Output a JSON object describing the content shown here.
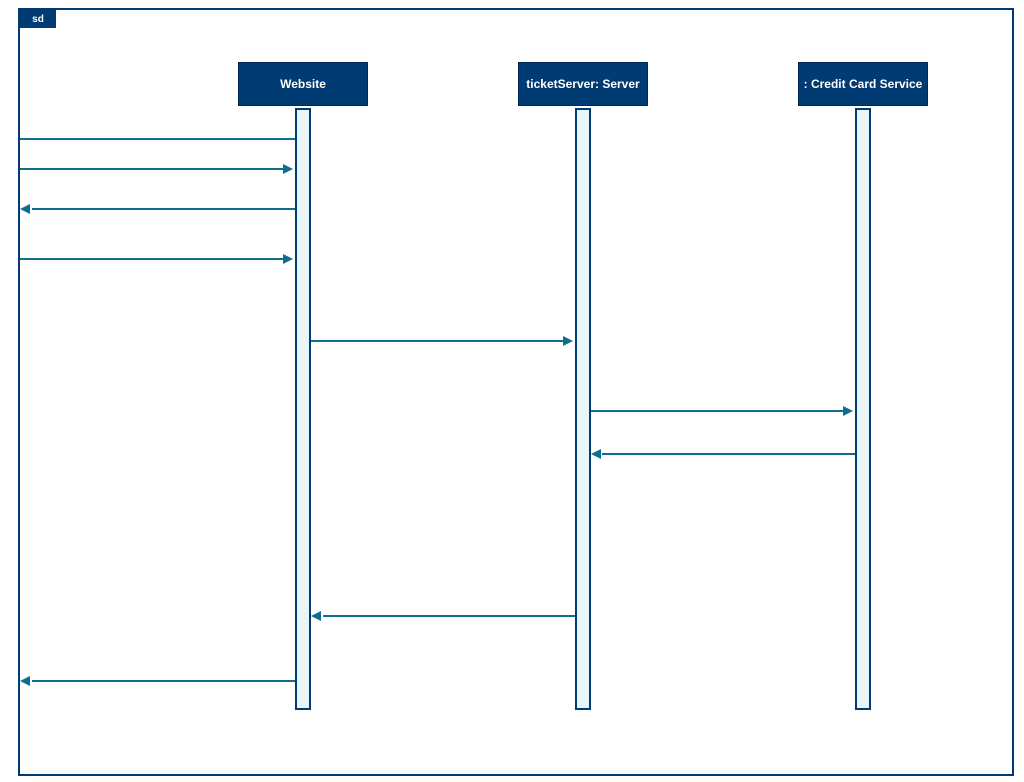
{
  "frame_label": "sd",
  "lifelines": {
    "website": "Website",
    "server": "ticketServer: Server",
    "credit": ": Credit Card Service"
  },
  "colors": {
    "primary": "#003b73",
    "arrow": "#0f6e8f",
    "activation_fill": "#e8f5f9"
  }
}
